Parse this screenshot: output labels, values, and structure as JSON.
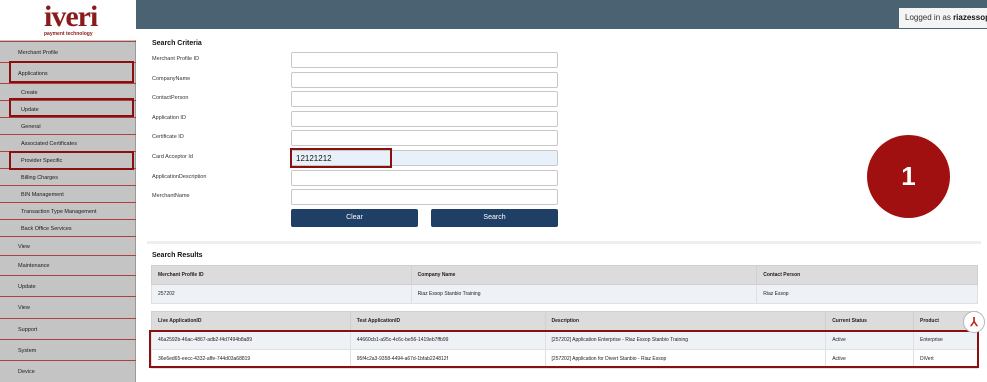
{
  "brand": {
    "logo": "iveri",
    "tagline": "payment technology"
  },
  "header": {
    "logged_in_label": "Logged in as",
    "username": "riazessop"
  },
  "sidebar": {
    "items": [
      {
        "label": "Merchant Profile",
        "caret": "▾"
      },
      {
        "label": "Applications",
        "caret": "▾"
      },
      {
        "label": "Create"
      },
      {
        "label": "Update",
        "caret": "▾"
      },
      {
        "label": "General"
      },
      {
        "label": "Associated Certificates"
      },
      {
        "label": "Provider Specific"
      },
      {
        "label": "Billing Charges"
      },
      {
        "label": "BIN Management"
      },
      {
        "label": "Transaction Type Management"
      },
      {
        "label": "Back Office Services"
      },
      {
        "label": "View",
        "caret": "▾"
      },
      {
        "label": "Maintenance",
        "caret": "▾"
      },
      {
        "label": "Update",
        "caret": "▾"
      },
      {
        "label": "View",
        "caret": "▾"
      },
      {
        "label": "Support",
        "caret": "▾"
      },
      {
        "label": "System",
        "caret": "▾"
      },
      {
        "label": "Device",
        "caret": "▾"
      }
    ]
  },
  "search": {
    "title": "Search Criteria",
    "fields": [
      {
        "label": "Merchant Profile ID",
        "value": ""
      },
      {
        "label": "CompanyName",
        "value": ""
      },
      {
        "label": "ContactPerson",
        "value": ""
      },
      {
        "label": "Application ID",
        "value": ""
      },
      {
        "label": "Certificate ID",
        "value": ""
      },
      {
        "label": "Card Acceptor Id",
        "value": "12121212"
      },
      {
        "label": "ApplicationDescription",
        "value": ""
      },
      {
        "label": "MerchantName",
        "value": ""
      }
    ],
    "clear_label": "Clear",
    "search_label": "Search"
  },
  "results": {
    "title": "Search Results",
    "merchant_columns": [
      "Merchant Profile ID",
      "Company Name",
      "Contact Person"
    ],
    "merchant_rows": [
      [
        "257202",
        "Riaz Essop Stanbio Training",
        "Riaz Essop"
      ]
    ],
    "app_columns": [
      "Live ApplicationID",
      "Test ApplicationID",
      "Description",
      "Current Status",
      "Product"
    ],
    "app_rows": [
      [
        "46a2592b-46ac-4867-adb2-f4d7494b8a89",
        "44660cb1-a95c-4c6c-be56-1419eb7ffb99",
        "[257202] Application Enterprise - Riaz Essop Stanbio Training",
        "Active",
        "Enterprise"
      ],
      [
        "36e6ed65-eecc-4332-affe-744d03a68819",
        "95f4c2a3-9358-4494-a67d-1bfab224812f",
        "[257202] Application for Divert Stanbio - Riaz Essop",
        "Active",
        "DiVert"
      ]
    ]
  },
  "annotation": {
    "step_number": "1"
  },
  "icons": {
    "pdf": "pdf-icon"
  },
  "colors": {
    "highlight": "#8b0f0f",
    "button": "#1f3f66",
    "topbar": "#4a6272",
    "badge": "#a01010"
  }
}
